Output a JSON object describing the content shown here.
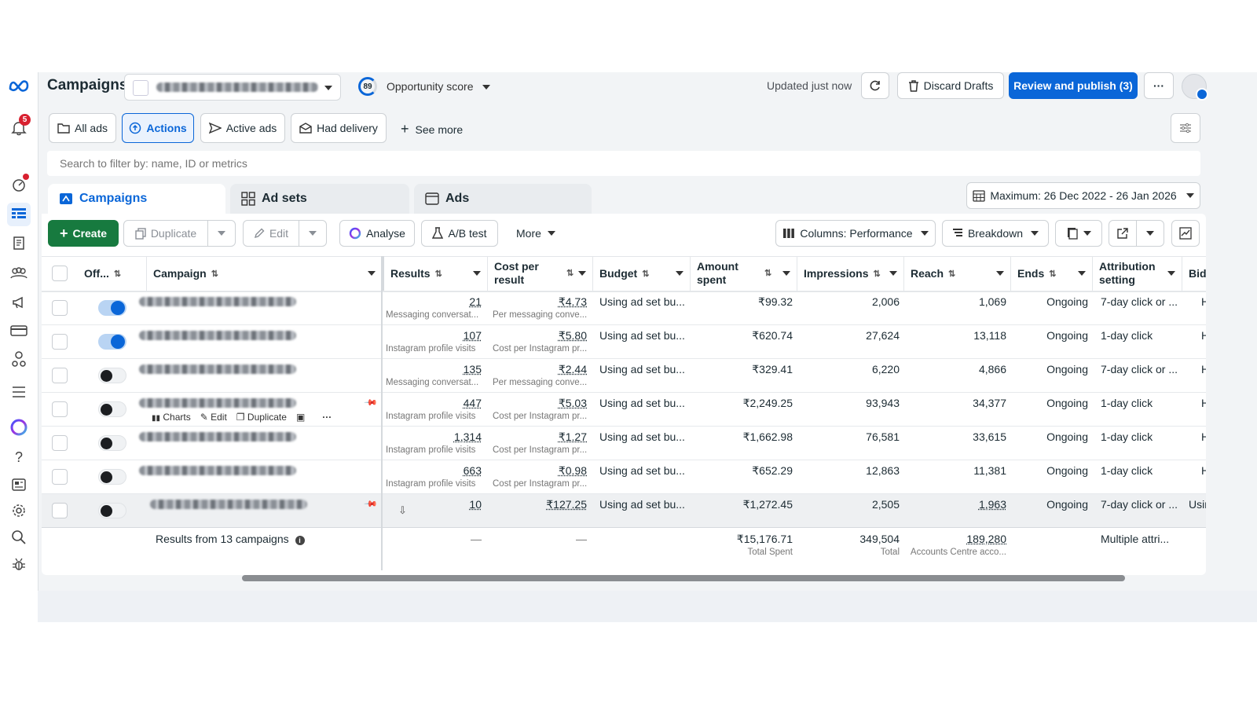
{
  "rail": {
    "notif_count": "5",
    "help": "?"
  },
  "header": {
    "title": "Campaigns",
    "opportunity_score": "89",
    "opportunity_label": "Opportunity score",
    "updated": "Updated just now",
    "discard": "Discard Drafts",
    "review": "Review and publish (3)",
    "more": "···"
  },
  "filters": {
    "all_ads": "All ads",
    "actions": "Actions",
    "active_ads": "Active ads",
    "had_delivery": "Had delivery",
    "see_more": "See more",
    "search_placeholder": "Search to filter by: name, ID or metrics"
  },
  "tabs": {
    "campaigns": "Campaigns",
    "ad_sets": "Ad sets",
    "ads": "Ads"
  },
  "date_range": "Maximum: 26 Dec 2022 - 26 Jan 2026",
  "toolbar": {
    "create": "Create",
    "duplicate": "Duplicate",
    "edit": "Edit",
    "analyse": "Analyse",
    "ab_test": "A/B test",
    "more": "More",
    "columns": "Columns: Performance",
    "breakdown": "Breakdown"
  },
  "columns": {
    "off": "Off...",
    "campaign": "Campaign",
    "results": "Results",
    "cost_per_result": "Cost per result",
    "budget": "Budget",
    "amount_spent": "Amount spent",
    "impressions": "Impressions",
    "reach": "Reach",
    "ends": "Ends",
    "attribution": "Attribution setting",
    "bid": "Bid"
  },
  "rows": [
    {
      "on": true,
      "results": "21",
      "results_sub": "Messaging conversat...",
      "cost": "₹4.73",
      "cost_sub": "Per messaging conve...",
      "budget": "Using ad set bu...",
      "spent": "₹99.32",
      "impressions": "2,006",
      "reach": "1,069",
      "ends": "Ongoing",
      "attribution": "7-day click or ...",
      "bid": "H"
    },
    {
      "on": true,
      "results": "107",
      "results_sub": "Instagram profile visits",
      "cost": "₹5.80",
      "cost_sub": "Cost per Instagram pr...",
      "budget": "Using ad set bu...",
      "spent": "₹620.74",
      "impressions": "27,624",
      "reach": "13,118",
      "ends": "Ongoing",
      "attribution": "1-day click",
      "bid": "H"
    },
    {
      "on": false,
      "results": "135",
      "results_sub": "Messaging conversat...",
      "cost": "₹2.44",
      "cost_sub": "Per messaging conve...",
      "budget": "Using ad set bu...",
      "spent": "₹329.41",
      "impressions": "6,220",
      "reach": "4,866",
      "ends": "Ongoing",
      "attribution": "7-day click or ...",
      "bid": "H"
    },
    {
      "on": false,
      "results": "447",
      "results_sub": "Instagram profile visits",
      "cost": "₹5.03",
      "cost_sub": "Cost per Instagram pr...",
      "budget": "Using ad set bu...",
      "spent": "₹2,249.25",
      "impressions": "93,943",
      "reach": "34,377",
      "ends": "Ongoing",
      "attribution": "1-day click",
      "bid": "H"
    },
    {
      "on": false,
      "results": "1,314",
      "results_sub": "Instagram profile visits",
      "cost": "₹1.27",
      "cost_sub": "Cost per Instagram pr...",
      "budget": "Using ad set bu...",
      "spent": "₹1,662.98",
      "impressions": "76,581",
      "reach": "33,615",
      "ends": "Ongoing",
      "attribution": "1-day click",
      "bid": "H"
    },
    {
      "on": false,
      "results": "663",
      "results_sub": "Instagram profile visits",
      "cost": "₹0.98",
      "cost_sub": "Cost per Instagram pr...",
      "budget": "Using ad set bu...",
      "spent": "₹652.29",
      "impressions": "12,863",
      "reach": "11,381",
      "ends": "Ongoing",
      "attribution": "1-day click",
      "bid": "H"
    },
    {
      "on": false,
      "results": "10",
      "results_sub": "",
      "cost": "₹127.25",
      "cost_sub": "",
      "budget": "Using ad set bu...",
      "spent": "₹1,272.45",
      "impressions": "2,505",
      "reach": "1,963",
      "ends": "Ongoing",
      "attribution": "7-day click or ...",
      "bid": "Usir"
    }
  ],
  "row_actions": {
    "charts": "Charts",
    "edit": "Edit",
    "duplicate": "Duplicate",
    "more": "···"
  },
  "totals": {
    "label": "Results from 13 campaigns",
    "results": "—",
    "cost": "—",
    "spent": "₹15,176.71",
    "spent_sub": "Total Spent",
    "impressions": "349,504",
    "impressions_sub": "Total",
    "reach": "189,280",
    "reach_sub": "Accounts Centre acco...",
    "attribution": "Multiple attri..."
  },
  "colors": {
    "accent": "#0a66d8",
    "create": "#177a3f",
    "badge": "#d8202f"
  }
}
